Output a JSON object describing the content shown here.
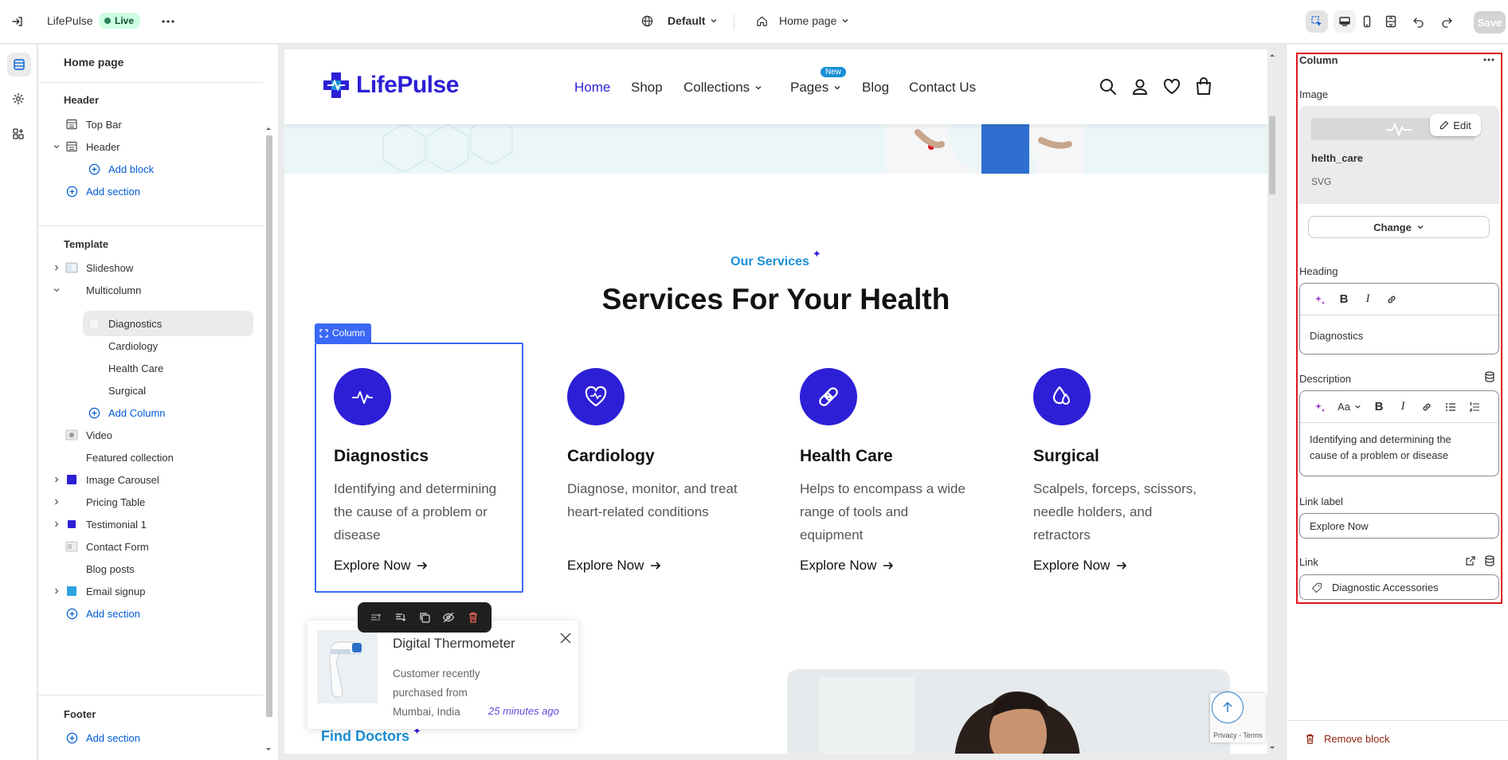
{
  "topbar": {
    "store_name": "LifePulse",
    "status": "Live",
    "theme": "Default",
    "page": "Home page",
    "save_label": "Save"
  },
  "left_panel": {
    "title": "Home page",
    "header_group": "Header",
    "header_items": [
      "Top Bar",
      "Header"
    ],
    "add_block": "Add block",
    "add_section": "Add section",
    "template_group": "Template",
    "template_items": [
      "Slideshow",
      "Multicolumn",
      "Diagnostics",
      "Cardiology",
      "Health Care",
      "Surgical",
      "Add Column",
      "Video",
      "Featured collection",
      "Image Carousel",
      "Pricing Table",
      "Testimonial 1",
      "Contact Form",
      "Blog posts",
      "Email signup"
    ],
    "footer_group": "Footer"
  },
  "site": {
    "logo": "LifePulse",
    "nav": [
      "Home",
      "Shop",
      "Collections",
      "Pages",
      "Blog",
      "Contact Us"
    ],
    "nav_badge": "New",
    "kicker": "Our Services",
    "heading": "Services For Your Health",
    "column_tag": "Column",
    "services": [
      {
        "title": "Diagnostics",
        "desc": "Identifying and determining the cause of a problem or disease",
        "link": "Explore Now",
        "icon": "pulse-icon"
      },
      {
        "title": "Cardiology",
        "desc": "Diagnose, monitor, and treat heart-related conditions",
        "link": "Explore Now",
        "icon": "heart-pulse-icon"
      },
      {
        "title": "Health Care",
        "desc": "Helps to encompass a wide range of tools and equipment",
        "link": "Explore Now",
        "icon": "bandage-icon"
      },
      {
        "title": "Surgical",
        "desc": "Scalpels, forceps, scissors, needle holders, and retractors",
        "link": "Explore Now",
        "icon": "drops-icon"
      }
    ],
    "popup": {
      "product": "Digital Thermometer",
      "text": "Customer recently purchased from Mumbai, India",
      "time": "25 minutes ago"
    },
    "find_doctors": "Find Doctors",
    "recaptcha": "Privacy - Terms"
  },
  "right_panel": {
    "title": "Column",
    "image_label": "Image",
    "image_name": "helth_care",
    "image_type": "SVG",
    "edit_label": "Edit",
    "change_label": "Change",
    "heading_label": "Heading",
    "heading_value": "Diagnostics",
    "description_label": "Description",
    "description_value": "Identifying and determining the cause of a problem or disease",
    "link_label_label": "Link label",
    "link_label_value": "Explore Now",
    "link_label": "Link",
    "link_value": "Diagnostic Accessories",
    "remove_block": "Remove block"
  },
  "colors": {
    "brand_blue": "#2d1fd6",
    "accent_sky": "#1a8fd6",
    "selection": "#3a68f5",
    "highlight_red": "#e0141e"
  }
}
